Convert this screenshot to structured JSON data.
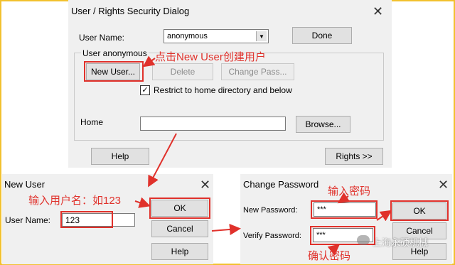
{
  "user_rights_dialog": {
    "title": "User / Rights Security Dialog",
    "user_name_label": "User Name:",
    "user_name_value": "anonymous",
    "done_label": "Done",
    "group_label": "User anonymous",
    "new_user_label": "New User...",
    "delete_label": "Delete",
    "change_pass_label": "Change Pass...",
    "restrict_label": "Restrict to home directory and below",
    "restrict_checked": true,
    "home_label": "Home",
    "home_value": "",
    "browse_label": "Browse...",
    "help_label": "Help",
    "rights_label": "Rights >>"
  },
  "new_user_dialog": {
    "title": "New User",
    "user_name_label": "User Name:",
    "user_name_value": "123",
    "ok_label": "OK",
    "cancel_label": "Cancel",
    "help_label": "Help"
  },
  "change_password_dialog": {
    "title": "Change Password",
    "new_password_label": "New Password:",
    "new_password_value": "***",
    "verify_password_label": "Verify Password:",
    "verify_password_value": "***",
    "ok_label": "OK",
    "cancel_label": "Cancel",
    "help_label": "Help"
  },
  "annotations": {
    "click_new_user": "点击New User创建用户",
    "enter_username": "输入用户名：如123",
    "enter_password": "输入密码",
    "confirm_password": "确认密码",
    "watermark": "上海永硕机械"
  },
  "colors": {
    "annotation_red": "#e0312b",
    "frame_yellow": "#f2c12e",
    "dialog_bg": "#f0f0f0"
  }
}
